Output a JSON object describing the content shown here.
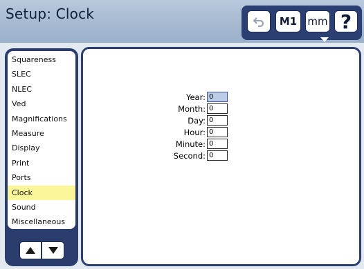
{
  "header": {
    "title": "Setup: Clock"
  },
  "toolbar": {
    "undo_icon": "undo-icon",
    "m1_label": "M1",
    "mm_label": "mm",
    "help_label": "?"
  },
  "sidebar": {
    "items": [
      {
        "label": "Squareness",
        "selected": false
      },
      {
        "label": "SLEC",
        "selected": false
      },
      {
        "label": "NLEC",
        "selected": false
      },
      {
        "label": "Ved",
        "selected": false
      },
      {
        "label": "Magnifications",
        "selected": false
      },
      {
        "label": "Measure",
        "selected": false
      },
      {
        "label": "Display",
        "selected": false
      },
      {
        "label": "Print",
        "selected": false
      },
      {
        "label": "Ports",
        "selected": false
      },
      {
        "label": "Clock",
        "selected": true
      },
      {
        "label": "Sound",
        "selected": false
      },
      {
        "label": "Miscellaneous",
        "selected": false
      }
    ],
    "selected_color": "#fbf69a"
  },
  "clock": {
    "fields": [
      {
        "label": "Year:",
        "value": "0",
        "active": true
      },
      {
        "label": "Month:",
        "value": "0",
        "active": false
      },
      {
        "label": "Day:",
        "value": "0",
        "active": false
      },
      {
        "label": "Hour:",
        "value": "0",
        "active": false
      },
      {
        "label": "Minute:",
        "value": "0",
        "active": false
      },
      {
        "label": "Second:",
        "value": "0",
        "active": false
      }
    ]
  },
  "colors": {
    "header_bg": "#a6b9d1",
    "frame": "#2c3e70",
    "active_field": "#bccbe6"
  }
}
